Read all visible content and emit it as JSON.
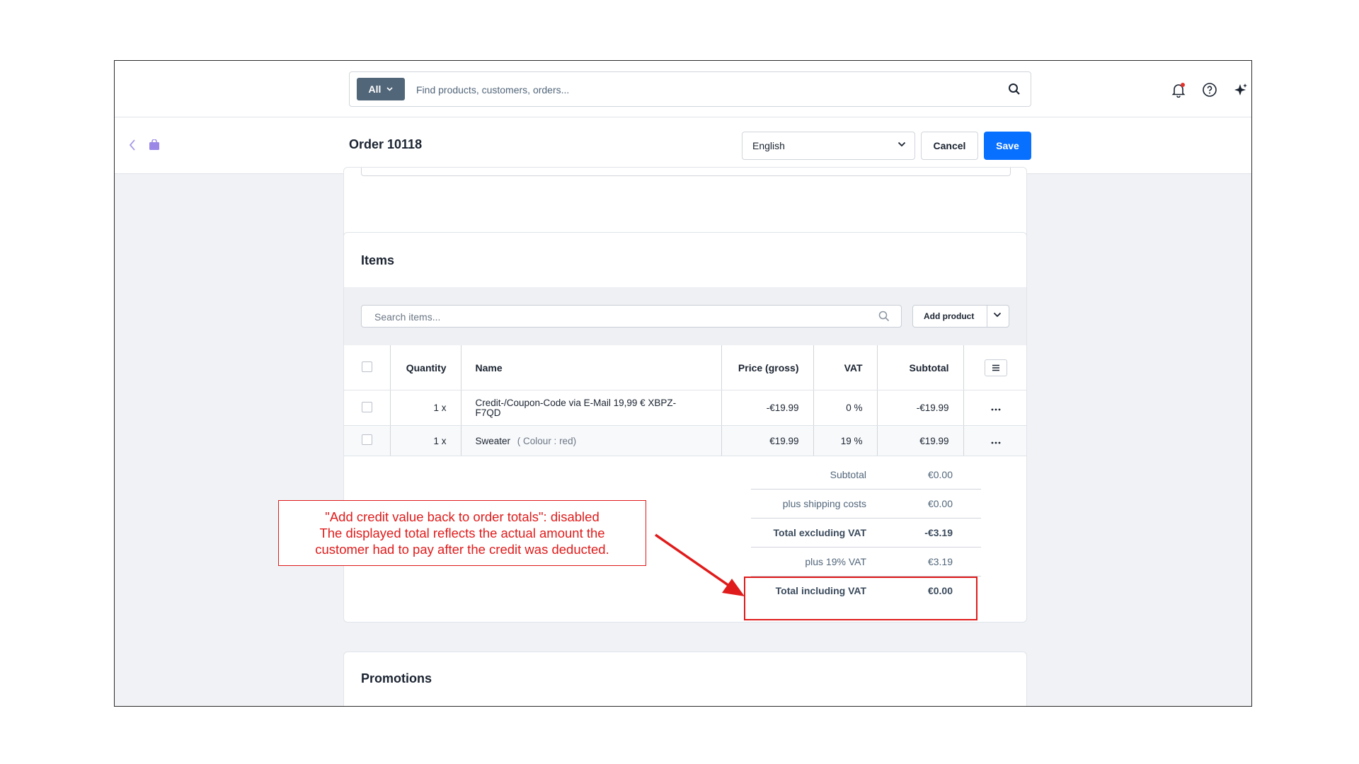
{
  "topbar": {
    "search_scope": "All",
    "search_placeholder": "Find products, customers, orders..."
  },
  "header": {
    "title": "Order 10118",
    "language": "English",
    "cancel_label": "Cancel",
    "save_label": "Save"
  },
  "items_card": {
    "title": "Items",
    "search_placeholder": "Search items...",
    "add_product_label": "Add product",
    "columns": [
      "Quantity",
      "Name",
      "Price (gross)",
      "VAT",
      "Subtotal"
    ],
    "rows": [
      {
        "quantity": "1 x",
        "name": "Credit-/Coupon-Code via E-Mail 19,99 € XBPZ-F7QD",
        "name_extra": "",
        "price": "-€19.99",
        "vat": "0 %",
        "subtotal": "-€19.99"
      },
      {
        "quantity": "1 x",
        "name": "Sweater",
        "name_extra": "( Colour : red)",
        "price": "€19.99",
        "vat": "19 %",
        "subtotal": "€19.99"
      }
    ],
    "totals": [
      {
        "label": "Subtotal",
        "value": "€0.00"
      },
      {
        "label": "plus shipping costs",
        "value": "€0.00"
      },
      {
        "label": "Total excluding VAT",
        "value": "-€3.19"
      },
      {
        "label": "plus 19% VAT",
        "value": "€3.19"
      },
      {
        "label": "Total including VAT",
        "value": "€0.00"
      }
    ]
  },
  "promotions_card": {
    "title": "Promotions"
  },
  "annotation": {
    "line1": "\"Add credit value back to order totals\": disabled",
    "line2": "The displayed total reflects the actual amount the",
    "line3": "customer had to pay after the credit was deducted."
  },
  "colors": {
    "primary": "#0870ff",
    "annotation_red": "#e01b1b",
    "scope_button": "#52667a",
    "notification_dot": "#e5322d",
    "bag_icon": "#9b87e6"
  }
}
